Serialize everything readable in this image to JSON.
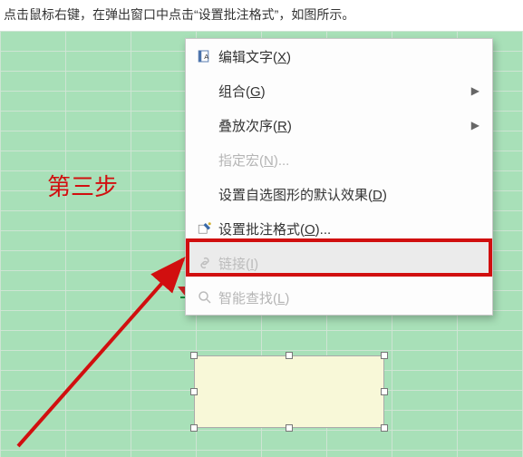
{
  "instruction": "点击鼠标右键，在弹出窗口中点击“设置批注格式”，如图所示。",
  "step_label": "第三步",
  "menu": {
    "items": [
      {
        "pre": "编辑文字(",
        "key": "X",
        "post": ")"
      },
      {
        "pre": "组合(",
        "key": "G",
        "post": ")"
      },
      {
        "pre": "叠放次序(",
        "key": "R",
        "post": ")"
      },
      {
        "pre": "指定宏(",
        "key": "N",
        "post": ")..."
      },
      {
        "pre": "设置自选图形的默认效果(",
        "key": "D",
        "post": ")"
      },
      {
        "pre": "设置批注格式(",
        "key": "O",
        "post": ")..."
      },
      {
        "pre": "链接(",
        "key": "I",
        "post": ")"
      },
      {
        "pre": "智能查找(",
        "key": "L",
        "post": ")"
      }
    ]
  }
}
